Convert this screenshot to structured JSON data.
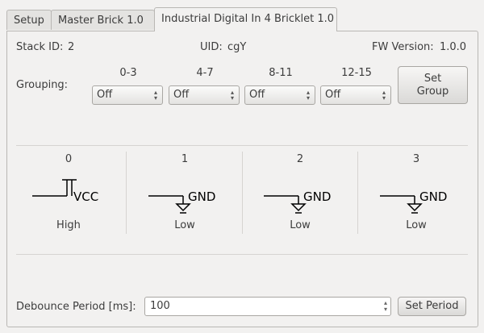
{
  "tabs": [
    {
      "label": "Setup"
    },
    {
      "label": "Master Brick 1.0"
    },
    {
      "label": "Industrial Digital In 4 Bricklet 1.0"
    }
  ],
  "info": {
    "stack_id_label": "Stack ID:",
    "stack_id": "2",
    "uid_label": "UID:",
    "uid": "cgY",
    "fw_label": "FW Version:",
    "fw": "1.0.0"
  },
  "grouping": {
    "label": "Grouping:",
    "columns": [
      {
        "header": "0-3",
        "value": "Off"
      },
      {
        "header": "4-7",
        "value": "Off"
      },
      {
        "header": "8-11",
        "value": "Off"
      },
      {
        "header": "12-15",
        "value": "Off"
      }
    ],
    "set_group_label": "Set\nGroup"
  },
  "channels": [
    {
      "index": "0",
      "level": "VCC",
      "state": "High"
    },
    {
      "index": "1",
      "level": "GND",
      "state": "Low"
    },
    {
      "index": "2",
      "level": "GND",
      "state": "Low"
    },
    {
      "index": "3",
      "level": "GND",
      "state": "Low"
    }
  ],
  "debounce": {
    "label": "Debounce Period [ms]:",
    "value": "100",
    "button_label": "Set Period"
  }
}
